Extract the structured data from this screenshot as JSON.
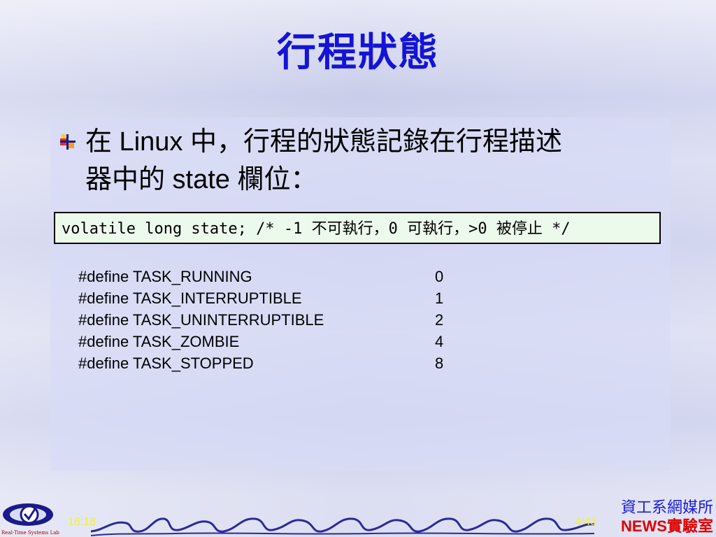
{
  "slide": {
    "title": "行程狀態",
    "bullet_lines": [
      "在 Linux 中，行程的狀態記錄在行程描述",
      "器中的 state 欄位："
    ],
    "code": "volatile long state; /* -1 不可執行，0 可執行，>0 被停止 */",
    "defines": [
      {
        "name": "#define TASK_RUNNING",
        "value": "0"
      },
      {
        "name": "#define TASK_INTERRUPTIBLE",
        "value": "1"
      },
      {
        "name": "#define TASK_UNINTERRUPTIBLE",
        "value": "2"
      },
      {
        "name": "#define TASK_ZOMBIE",
        "value": "4"
      },
      {
        "name": "#define TASK_STOPPED",
        "value": "8"
      }
    ]
  },
  "footer": {
    "time": "16:18",
    "page": "4/43",
    "logo_text": "Real-Time Systems Lab",
    "dept_line1": "資工系網媒所",
    "dept_line2": "NEWS實驗室"
  },
  "colors": {
    "title": "#1414d6",
    "code_bg": "#ecfaec",
    "footer_text": "#f0f03a",
    "dept_blue": "#1a1ad8",
    "dept_red": "#e00000"
  },
  "icons": {
    "bullet": "bullet-square-icon",
    "logo": "lab-logo-icon"
  }
}
